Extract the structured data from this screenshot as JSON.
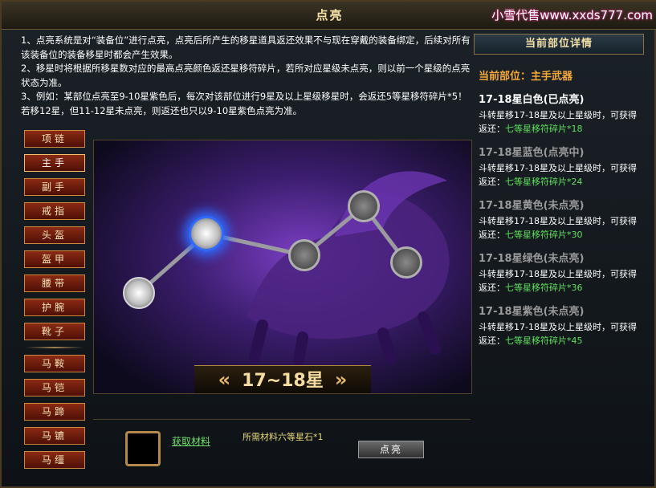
{
  "window": {
    "title": "点亮",
    "watermark": "小雪代售www.xxds777.com"
  },
  "notes": [
    "1、点亮系统是对“装备位”进行点亮，点亮后所产生的移星道具返还效果不与现在穿戴的装备绑定，后续对所有该装备位的装备移星时都会产生效果。",
    "2、移星时将根据所移星数对应的最高点亮颜色返还星移符碎片，若所对应星级未点亮，则以前一个星级的点亮状态为准。",
    "3、例如：某部位点亮至9-10星紫色后，每次对该部位进行9星及以上星级移星时，会返还5等星移符碎片*5！若移12星，但11-12星未点亮，则返还也只以9-10星紫色点亮为准。"
  ],
  "slots": [
    "项链",
    "主手",
    "副手",
    "戒指",
    "头盔",
    "盔甲",
    "腰带",
    "护腕",
    "靴子",
    "马鞍",
    "马铠",
    "马蹄",
    "马镳",
    "马缰"
  ],
  "active_slot": "主手",
  "stage": {
    "banner": "17~18星"
  },
  "bottom": {
    "get_material": "获取材料",
    "need": "所需材料六等星石*1",
    "light_button": "点亮"
  },
  "right": {
    "header": "当前部位详情",
    "current": "当前部位：主手武器",
    "stars": [
      {
        "name": "17-18星白色(已点亮)",
        "lit": true,
        "desc": "斗转星移17-18星及以上星级时，可获得返还：",
        "frag": "七等星移符碎片*18"
      },
      {
        "name": "17-18星蓝色(点亮中)",
        "lit": false,
        "desc": "斗转星移17-18星及以上星级时，可获得返还：",
        "frag": "七等星移符碎片*24"
      },
      {
        "name": "17-18星黄色(未点亮)",
        "lit": false,
        "desc": "斗转星移17-18星及以上星级时，可获得返还：",
        "frag": "七等星移符碎片*30"
      },
      {
        "name": "17-18星绿色(未点亮)",
        "lit": false,
        "desc": "斗转星移17-18星及以上星级时，可获得返还：",
        "frag": "七等星移符碎片*36"
      },
      {
        "name": "17-18星紫色(未点亮)",
        "lit": false,
        "desc": "斗转星移17-18星及以上星级时，可获得返还：",
        "frag": "七等星移符碎片*45"
      }
    ]
  },
  "colors": {
    "accent": "#f3a73a",
    "fragment": "#5fe05f",
    "node_active": "#2f6bff"
  }
}
